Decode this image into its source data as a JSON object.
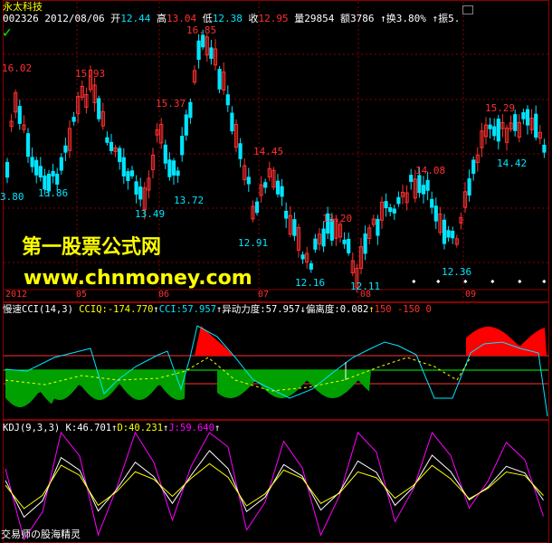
{
  "app": {
    "title": "永太科技"
  },
  "header": {
    "code": "002326",
    "date": "2012/08/06",
    "open_label": "开",
    "open": "12.44",
    "high_label": "高",
    "high": "13.04",
    "low_label": "低",
    "low": "12.38",
    "close_label": "收",
    "close": "12.95",
    "volume_label": "量",
    "volume": "29854",
    "amount_label": "额",
    "amount": "3786",
    "turnover_label": "换",
    "turnover": "3.80%",
    "amplitude_label": "振",
    "amplitude": "5."
  },
  "price_labels": [
    "16.85",
    "16.02",
    "15.93",
    "15.37",
    "15.29",
    "14.45",
    "14.42",
    "14.08",
    "13.86",
    "13.72",
    "13.49",
    "13.20",
    "12.91",
    "12.36",
    "12.16",
    "12.11",
    "3.80"
  ],
  "time_axis": [
    "2012",
    "05",
    "06",
    "07",
    "08",
    "09"
  ],
  "watermark": {
    "line1": "第一股票公式网",
    "line2": "www.chnmoney.com"
  },
  "cci_panel": {
    "name": "慢速CCI(14,3)",
    "cciq": "CCIQ:-174.770",
    "cci": "CCI:57.957",
    "force": "异动力度:57.957",
    "deviation": "偏离度:0.082",
    "levels": "150  -150  0"
  },
  "kdj_panel": {
    "name": "KDJ(9,3,3)",
    "k": "K:46.701",
    "d": "D:40.231",
    "j": "J:59.640"
  },
  "footer": {
    "credit": "交易师の股海精灵"
  },
  "colors": {
    "up": "#ff3030",
    "down": "#00e5ff",
    "yellow": "#ffff00",
    "magenta": "#ff00ff",
    "green": "#00ff00",
    "white": "#ffffff",
    "grid": "#8b0000"
  }
}
